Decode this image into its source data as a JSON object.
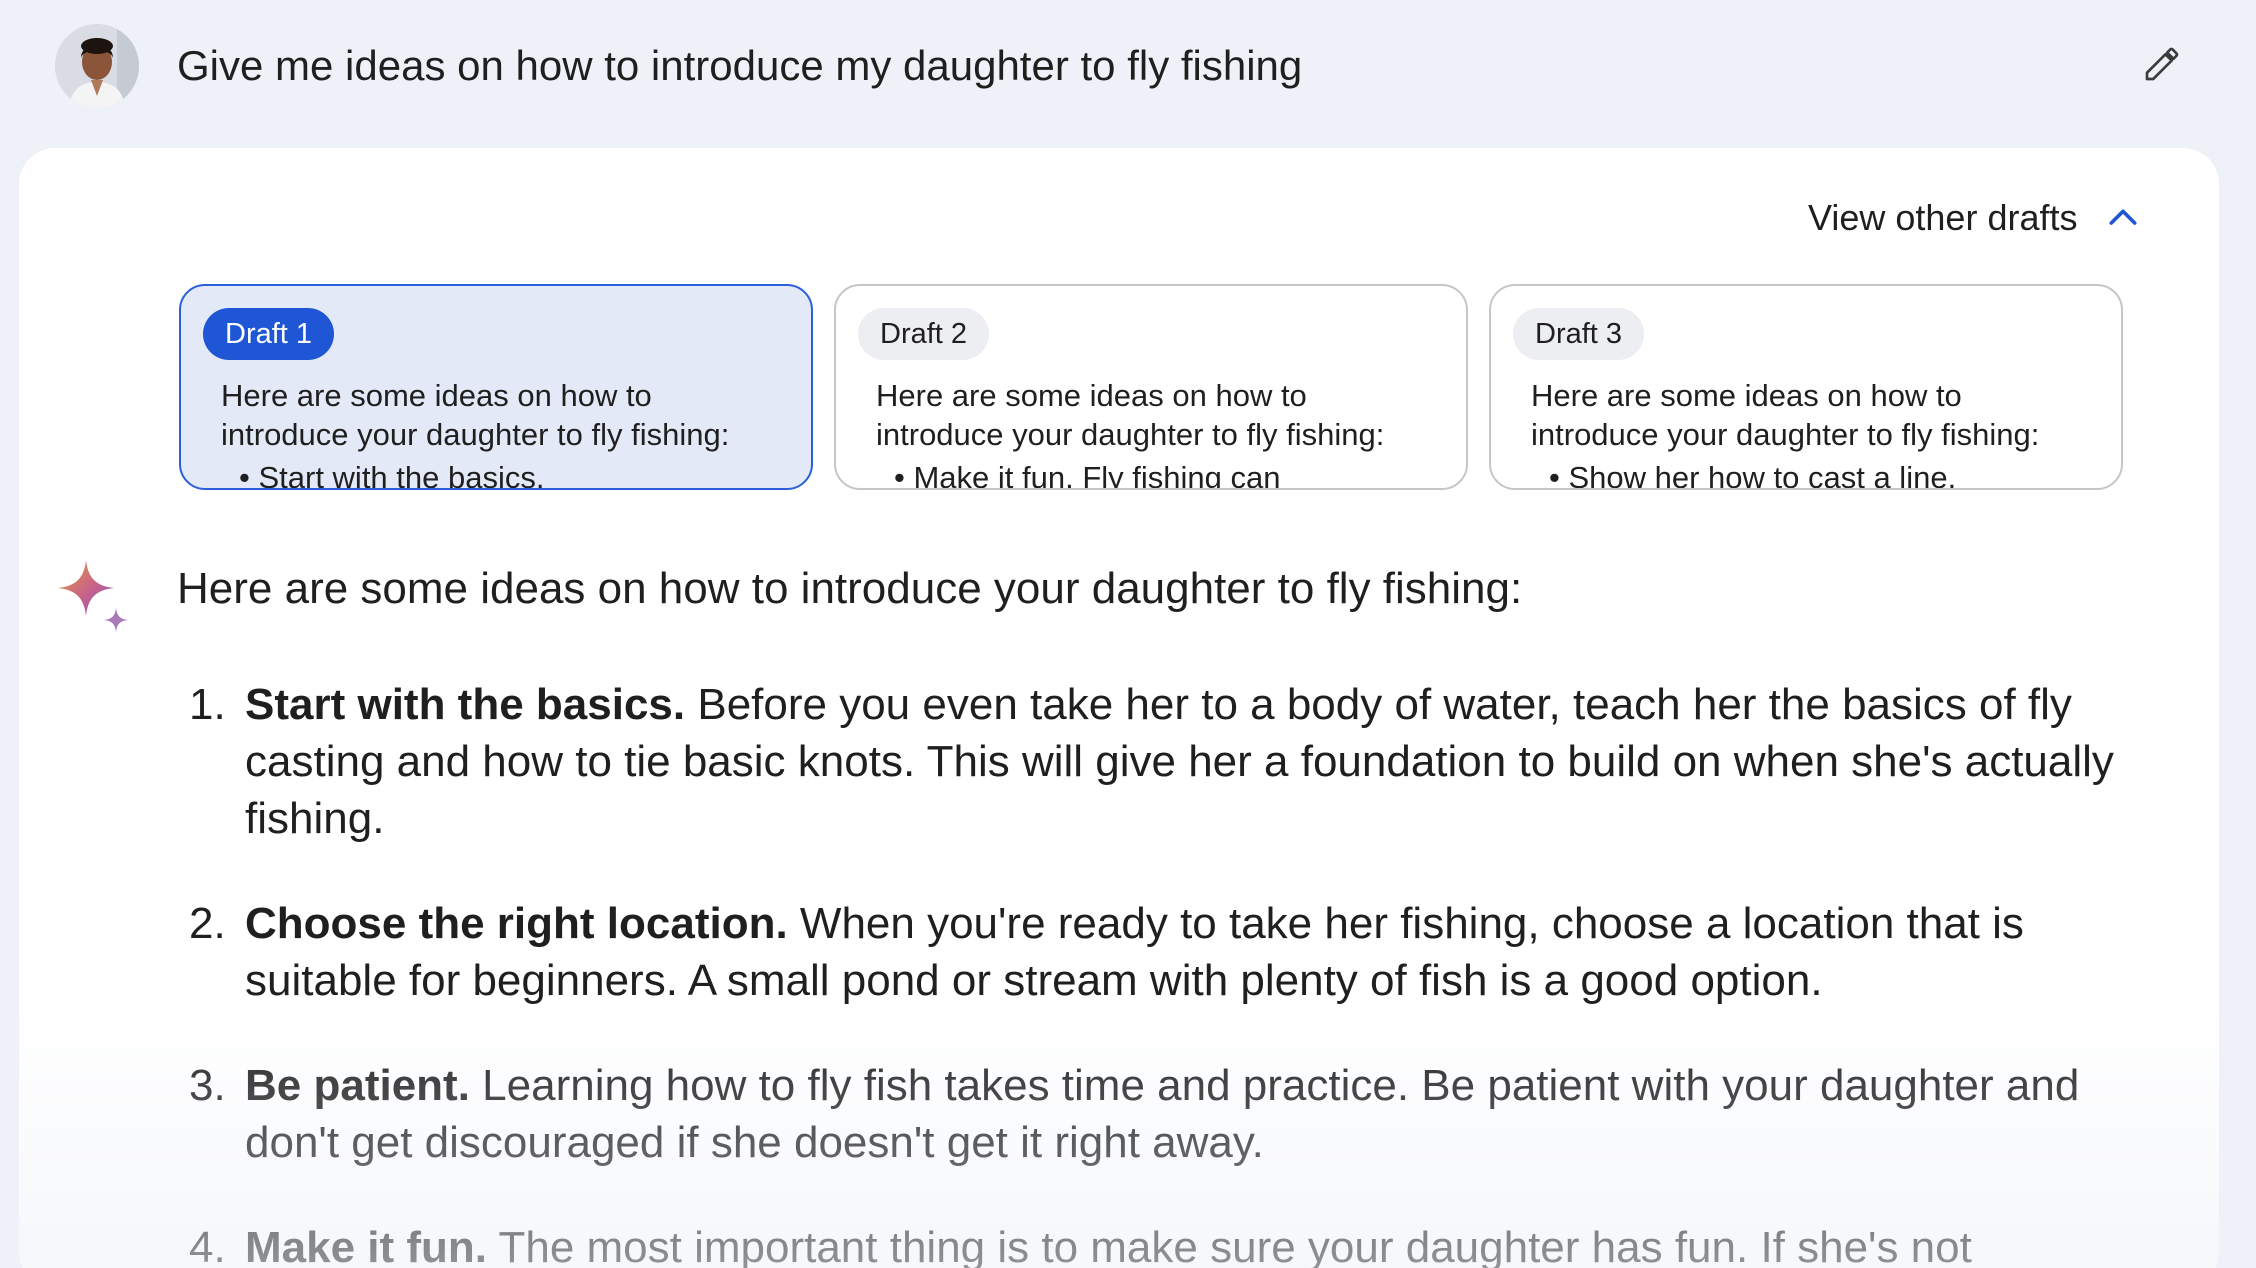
{
  "prompt": {
    "text": "Give me ideas on how to introduce my daughter to fly fishing"
  },
  "drafts_toggle": {
    "label": "View other drafts"
  },
  "drafts": [
    {
      "label": "Draft 1",
      "text": "Here are some ideas on how to introduce your daughter to fly fishing:",
      "bullet": "Start with the basics."
    },
    {
      "label": "Draft 2",
      "text": "Here are some ideas on how to introduce your daughter to fly fishing:",
      "bullet": "Make it fun. Fly fishing can"
    },
    {
      "label": "Draft 3",
      "text": "Here are some ideas on how to introduce your daughter to fly fishing:",
      "bullet": "Show her how to cast a line."
    }
  ],
  "response": {
    "intro": "Here are some ideas on how to introduce your daughter to fly fishing:",
    "items": [
      {
        "num": "1.",
        "title": "Start with the basics.",
        "body": "Before you even take her to a body of water, teach her the basics of fly casting and how to tie basic knots. This will give her a foundation to build on when she's actually fishing."
      },
      {
        "num": "2.",
        "title": "Choose the right location.",
        "body": "When you're ready to take her fishing, choose a location that is suitable for beginners. A small pond or stream with plenty of fish is a good option."
      },
      {
        "num": "3.",
        "title": "Be patient.",
        "body": "Learning how to fly fish takes time and practice. Be patient with your daughter and don't get discouraged if she doesn't get it right away."
      },
      {
        "num": "4.",
        "title": "Make it fun.",
        "body": "The most important thing is to make sure your daughter has fun. If she's not"
      }
    ]
  },
  "colors": {
    "page_bg": "#eef1f7",
    "card_bg": "#ffffff",
    "accent_blue": "#1e56d6",
    "selected_draft_bg": "#e3e9f7"
  },
  "icons": {
    "user": "avatar",
    "edit": "pencil-icon",
    "toggle": "chevron-up-icon",
    "assistant": "sparkle-icon"
  }
}
